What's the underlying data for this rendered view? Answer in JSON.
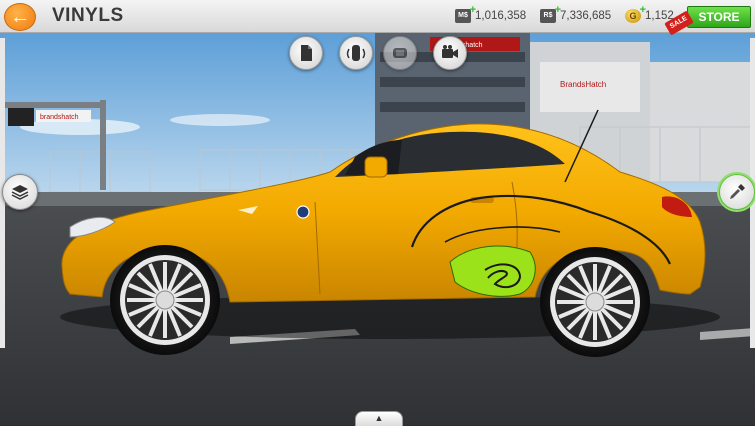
{
  "header": {
    "title": "VINYLS",
    "store_label": "STORE",
    "sale_label": "SALE"
  },
  "currencies": [
    {
      "icon": "ms-gold-icon",
      "badge": "M$",
      "value": "1,016,358"
    },
    {
      "icon": "rs-cash-icon",
      "badge": "R$",
      "value": "7,336,685"
    },
    {
      "icon": "gold-coin-icon",
      "badge": "G",
      "value": "1,152"
    }
  ],
  "scene": {
    "trackside_signs": [
      "brandshatch",
      "BrandsHatch"
    ]
  },
  "colors": {
    "car_body": "#f2a900",
    "vinyl_green": "#9be21a",
    "store_green": "#3cbf20",
    "accent_orange": "#f08a1c"
  }
}
